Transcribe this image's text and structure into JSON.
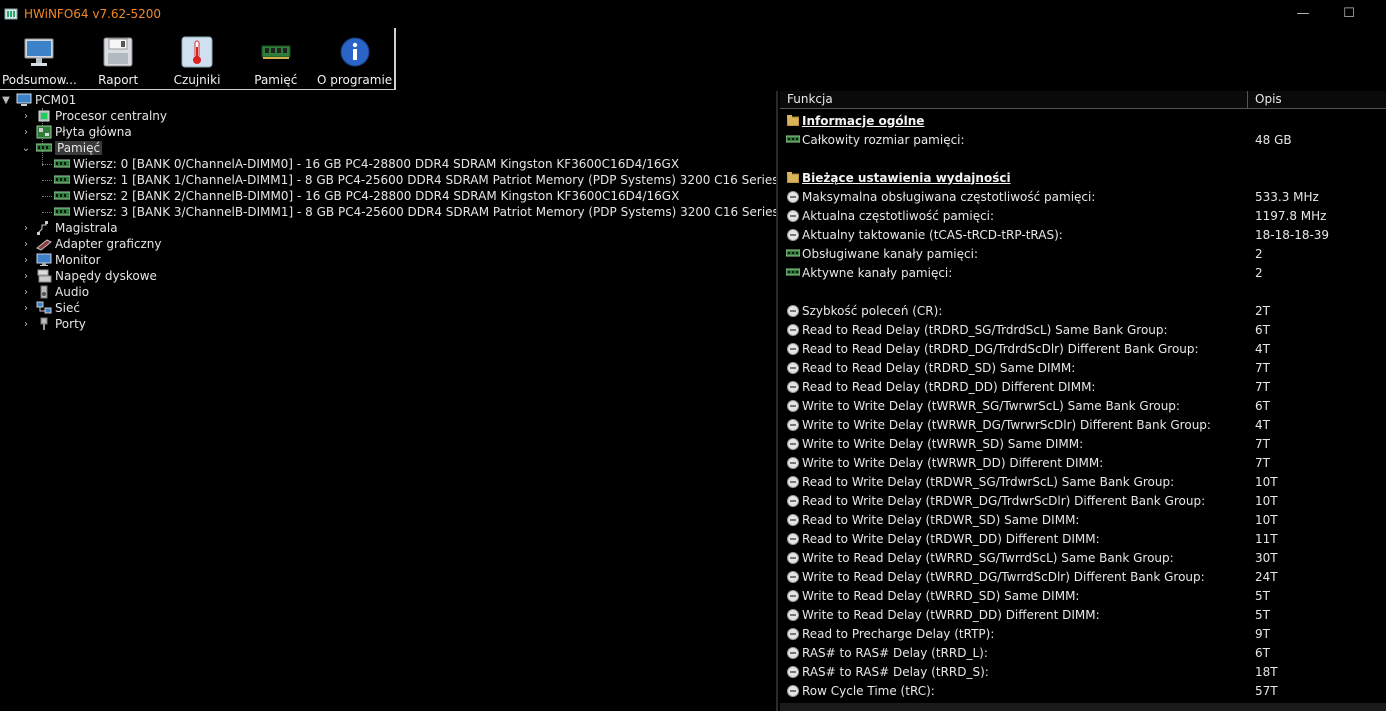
{
  "window": {
    "title": "HWiNFO64 v7.62-5200",
    "minimize_glyph": "—",
    "maximize_glyph": "☐"
  },
  "toolbar": {
    "buttons": [
      {
        "label": "Podsumow...",
        "icon": "monitor-icon"
      },
      {
        "label": "Raport",
        "icon": "floppy-icon"
      },
      {
        "label": "Czujniki",
        "icon": "thermometer-icon"
      },
      {
        "label": "Pamięć",
        "icon": "ram-icon"
      },
      {
        "label": "O programie",
        "icon": "info-icon"
      }
    ]
  },
  "tree": {
    "root": "PCM01",
    "items": [
      {
        "label": "Procesor centralny",
        "icon": "cpu-icon"
      },
      {
        "label": "Płyta główna",
        "icon": "motherboard-icon"
      },
      {
        "label": "Pamięć",
        "icon": "ram-icon"
      },
      {
        "label": "Magistrala",
        "icon": "bus-icon"
      },
      {
        "label": "Adapter graficzny",
        "icon": "gpu-icon"
      },
      {
        "label": "Monitor",
        "icon": "monitor-icon"
      },
      {
        "label": "Napędy dyskowe",
        "icon": "disk-icon"
      },
      {
        "label": "Audio",
        "icon": "speaker-icon"
      },
      {
        "label": "Sieć",
        "icon": "network-icon"
      },
      {
        "label": "Porty",
        "icon": "port-icon"
      }
    ],
    "memory_children": [
      "Wiersz: 0 [BANK 0/ChannelA-DIMM0] - 16 GB PC4-28800 DDR4 SDRAM Kingston KF3600C16D4/16GX",
      "Wiersz: 1 [BANK 1/ChannelA-DIMM1] - 8 GB PC4-25600 DDR4 SDRAM Patriot Memory (PDP Systems) 3200 C16 Series",
      "Wiersz: 2 [BANK 2/ChannelB-DIMM0] - 16 GB PC4-28800 DDR4 SDRAM Kingston KF3600C16D4/16GX",
      "Wiersz: 3 [BANK 3/ChannelB-DIMM1] - 8 GB PC4-25600 DDR4 SDRAM Patriot Memory (PDP Systems) 3200 C16 Series"
    ]
  },
  "detail": {
    "col_function": "Funkcja",
    "col_description": "Opis",
    "rows": [
      {
        "kind": "section",
        "name": "Informacje ogólne",
        "value": ""
      },
      {
        "kind": "ram",
        "name": "Całkowity rozmiar pamięci:",
        "value": "48 GB"
      },
      {
        "kind": "blank",
        "name": "",
        "value": ""
      },
      {
        "kind": "section",
        "name": "Bieżące ustawienia wydajności",
        "value": ""
      },
      {
        "kind": "clock",
        "name": "Maksymalna obsługiwana częstotliwość pamięci:",
        "value": "533.3 MHz"
      },
      {
        "kind": "clock",
        "name": "Aktualna częstotliwość pamięci:",
        "value": "1197.8 MHz"
      },
      {
        "kind": "clock",
        "name": "Aktualny taktowanie (tCAS-tRCD-tRP-tRAS):",
        "value": "18-18-18-39"
      },
      {
        "kind": "ram",
        "name": "Obsługiwane kanały pamięci:",
        "value": "2"
      },
      {
        "kind": "ram",
        "name": "Aktywne kanały pamięci:",
        "value": "2"
      },
      {
        "kind": "blank",
        "name": "",
        "value": ""
      },
      {
        "kind": "clock",
        "name": "Szybkość poleceń (CR):",
        "value": "2T"
      },
      {
        "kind": "clock",
        "name": "Read to Read Delay (tRDRD_SG/TrdrdScL) Same Bank Group:",
        "value": "6T"
      },
      {
        "kind": "clock",
        "name": "Read to Read Delay (tRDRD_DG/TrdrdScDlr) Different Bank Group:",
        "value": "4T"
      },
      {
        "kind": "clock",
        "name": "Read to Read Delay (tRDRD_SD) Same DIMM:",
        "value": "7T"
      },
      {
        "kind": "clock",
        "name": "Read to Read Delay (tRDRD_DD) Different DIMM:",
        "value": "7T"
      },
      {
        "kind": "clock",
        "name": "Write to Write Delay (tWRWR_SG/TwrwrScL) Same Bank Group:",
        "value": "6T"
      },
      {
        "kind": "clock",
        "name": "Write to Write Delay (tWRWR_DG/TwrwrScDlr) Different Bank Group:",
        "value": "4T"
      },
      {
        "kind": "clock",
        "name": "Write to Write Delay (tWRWR_SD) Same DIMM:",
        "value": "7T"
      },
      {
        "kind": "clock",
        "name": "Write to Write Delay (tWRWR_DD) Different DIMM:",
        "value": "7T"
      },
      {
        "kind": "clock",
        "name": "Read to Write Delay (tRDWR_SG/TrdwrScL) Same Bank Group:",
        "value": "10T"
      },
      {
        "kind": "clock",
        "name": "Read to Write Delay (tRDWR_DG/TrdwrScDlr) Different Bank Group:",
        "value": "10T"
      },
      {
        "kind": "clock",
        "name": "Read to Write Delay (tRDWR_SD) Same DIMM:",
        "value": "10T"
      },
      {
        "kind": "clock",
        "name": "Read to Write Delay (tRDWR_DD) Different DIMM:",
        "value": "11T"
      },
      {
        "kind": "clock",
        "name": "Write to Read Delay (tWRRD_SG/TwrrdScL) Same Bank Group:",
        "value": "30T"
      },
      {
        "kind": "clock",
        "name": "Write to Read Delay (tWRRD_DG/TwrrdScDlr) Different Bank Group:",
        "value": "24T"
      },
      {
        "kind": "clock",
        "name": "Write to Read Delay (tWRRD_SD) Same DIMM:",
        "value": "5T"
      },
      {
        "kind": "clock",
        "name": "Write to Read Delay (tWRRD_DD) Different DIMM:",
        "value": "5T"
      },
      {
        "kind": "clock",
        "name": "Read to Precharge Delay (tRTP):",
        "value": "9T"
      },
      {
        "kind": "clock",
        "name": "RAS# to RAS# Delay (tRRD_L):",
        "value": "6T"
      },
      {
        "kind": "clock",
        "name": "RAS# to RAS# Delay (tRRD_S):",
        "value": "18T"
      },
      {
        "kind": "clock",
        "name": "Row Cycle Time (tRC):",
        "value": "57T"
      }
    ]
  },
  "colors": {
    "title": "#f0882a",
    "background": "#000000",
    "text": "#e8e8e8",
    "selection": "#3a3a3a"
  }
}
